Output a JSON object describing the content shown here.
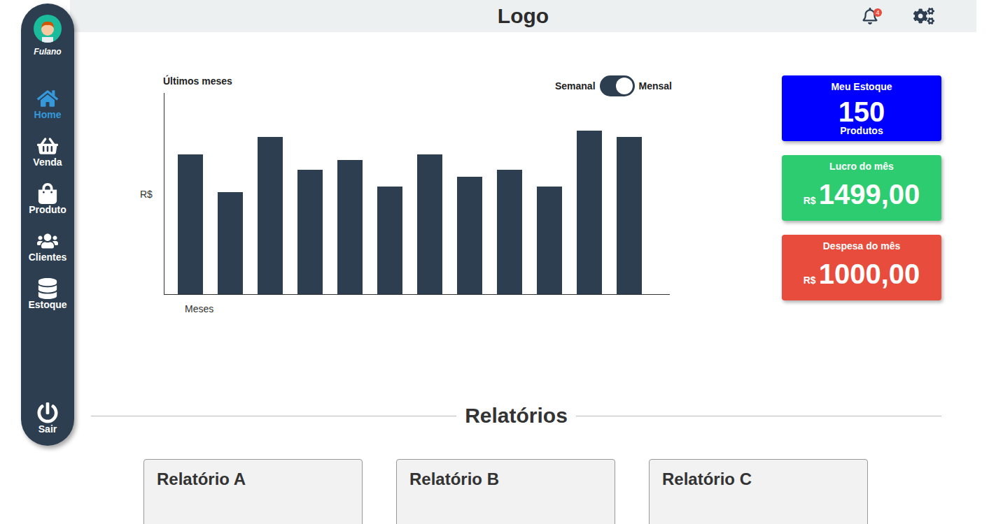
{
  "topbar": {
    "logo": "Logo",
    "notifications": {
      "count": "4"
    }
  },
  "user": {
    "name": "Fulano"
  },
  "sidebar": {
    "items": [
      {
        "label": "Home",
        "selected": true
      },
      {
        "label": "Venda",
        "selected": false
      },
      {
        "label": "Produto",
        "selected": false
      },
      {
        "label": "Clientes",
        "selected": false
      },
      {
        "label": "Estoque",
        "selected": false
      }
    ],
    "logout": "Sair"
  },
  "chart": {
    "title": "Últimos meses",
    "y_label": "R$",
    "x_label": "Meses",
    "toggle": {
      "left": "Semanal",
      "right": "Mensal",
      "on": true
    },
    "series": [
      {
        "values": [
          201,
          147,
          226,
          179,
          193,
          155,
          201,
          169,
          179,
          155,
          235,
          226
        ]
      }
    ]
  },
  "stats": [
    {
      "kind": "count",
      "title": "Meu Estoque",
      "value": "150",
      "unit": "Produtos",
      "color": "#0000ff"
    },
    {
      "kind": "currency",
      "title": "Lucro do mês",
      "value": "1499,00",
      "unit": "R$",
      "color": "#2ecc71"
    },
    {
      "kind": "currency",
      "title": "Despesa do mês",
      "value": "1000,00",
      "unit": "R$",
      "color": "#e74c3c"
    }
  ],
  "reports": {
    "title": "Relatórios",
    "items": [
      "Relatório A",
      "Relatório B",
      "Relatório C"
    ]
  }
}
